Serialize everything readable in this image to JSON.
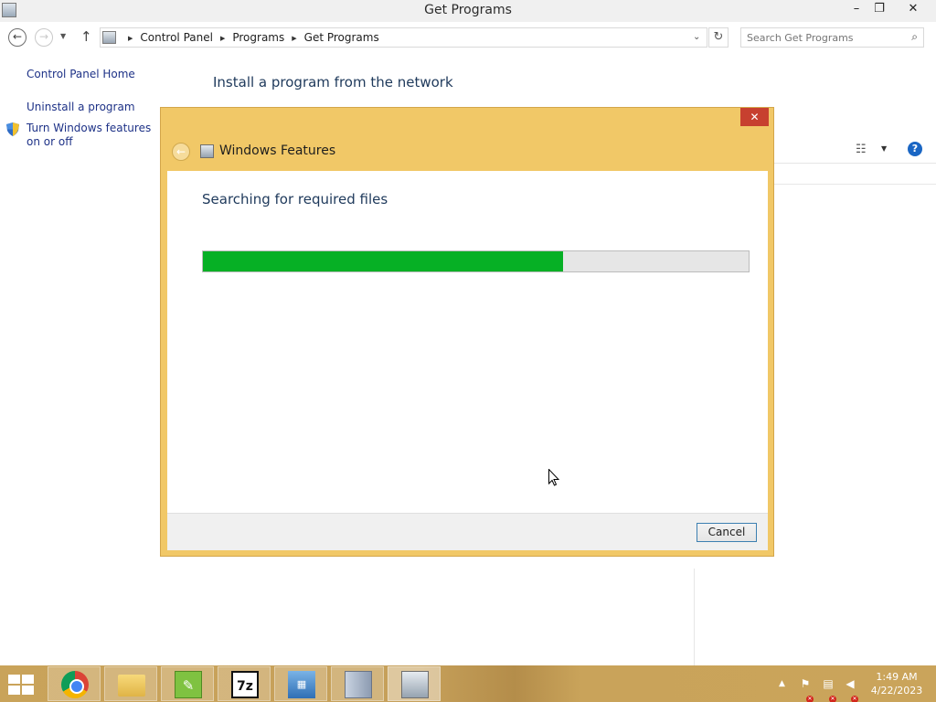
{
  "window": {
    "title": "Get Programs",
    "controls": {
      "minimize": "–",
      "maximize": "❐",
      "close": "✕"
    }
  },
  "address": {
    "breadcrumbs": [
      "Control Panel",
      "Programs",
      "Get Programs"
    ],
    "search_placeholder": "Search Get Programs"
  },
  "left_pane": {
    "home": "Control Panel Home",
    "uninstall": "Uninstall a program",
    "features": "Turn Windows features on or off"
  },
  "main": {
    "heading": "Install a program from the network"
  },
  "dialog": {
    "title": "Windows Features",
    "close": "✕",
    "status": "Searching for required files",
    "progress": 0.66,
    "cancel_label": "Cancel"
  },
  "taskbar": {
    "apps": [
      "chrome",
      "file-explorer",
      "notepad-plus-plus",
      "7-zip",
      "remote-desktop",
      "installer",
      "windows-features"
    ],
    "sevenz_glyph": "7z",
    "time": "1:49 AM",
    "date": "4/22/2023"
  },
  "colors": {
    "dialog_frame": "#f1c867",
    "progress_fill": "#06b025",
    "link": "#1e3287",
    "heading": "#1e395b",
    "taskbar": "#c9a35a"
  }
}
